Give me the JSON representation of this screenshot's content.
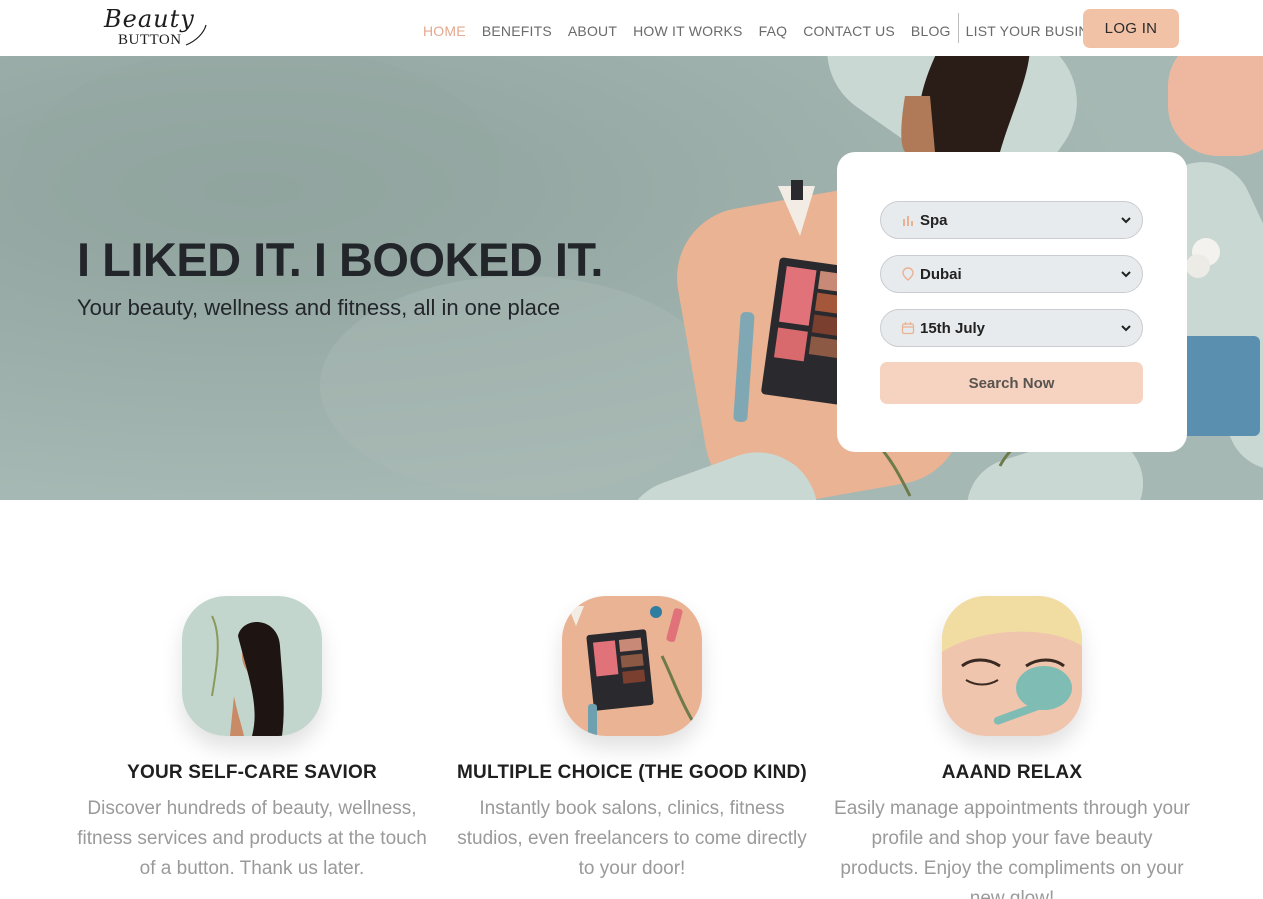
{
  "brand": {
    "logo_top": "Beauty",
    "logo_bottom": "BUTTON"
  },
  "nav": {
    "items": [
      "HOME",
      "BENEFITS",
      "ABOUT",
      "HOW IT WORKS",
      "FAQ",
      "CONTACT US",
      "BLOG"
    ],
    "active": "HOME",
    "list_business": "LIST YOUR BUSINESS",
    "login": "LOG IN"
  },
  "hero": {
    "title": "I LIKED IT. I BOOKED IT.",
    "subtitle": "Your beauty, wellness and fitness, all in one place"
  },
  "search": {
    "category": {
      "value": "Spa",
      "icon": "spa-icon"
    },
    "location": {
      "value": "Dubai",
      "icon": "location-pin-icon"
    },
    "date": {
      "value": "15th July",
      "icon": "calendar-icon"
    },
    "button": "Search Now"
  },
  "features": [
    {
      "icon": "woman-illustration",
      "title": "YOUR SELF-CARE SAVIOR",
      "text": "Discover hundreds of beauty, wellness, fitness services and products at the touch of a button. Thank us later."
    },
    {
      "icon": "makeup-palette-illustration",
      "title": "MULTIPLE CHOICE (THE GOOD KIND)",
      "text": "Instantly book salons, clinics, fitness studios, even freelancers to come directly to your door!"
    },
    {
      "icon": "face-mask-illustration",
      "title": "AAAND RELAX",
      "text": "Easily manage appointments through your profile and shop your fave beauty products. Enjoy the compliments on your new glow!"
    }
  ],
  "colors": {
    "accent": "#f2c2a7",
    "hero_bg": "#9fb2ad",
    "active_nav": "#e3a98d"
  }
}
